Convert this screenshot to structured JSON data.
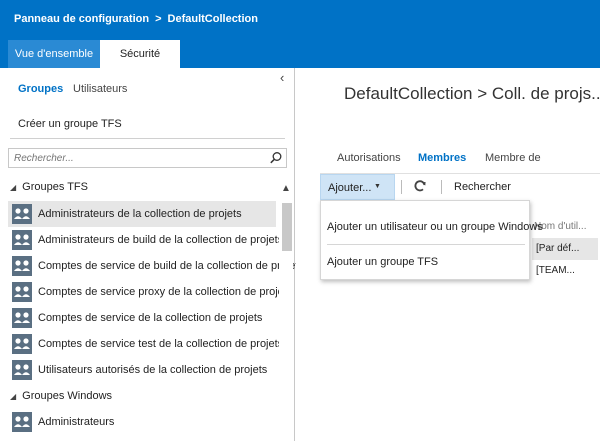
{
  "breadcrumb": {
    "root": "Panneau de configuration",
    "separator": ">",
    "current": "DefaultCollection"
  },
  "tabs": {
    "overview": "Vue d'ensemble",
    "security": "Sécurité"
  },
  "left": {
    "subnav": {
      "groups": "Groupes",
      "users": "Utilisateurs"
    },
    "create_group": "Créer un groupe TFS",
    "search_placeholder": "Rechercher...",
    "sections": {
      "tfs": "Groupes TFS",
      "windows": "Groupes Windows"
    },
    "tfs_groups": [
      {
        "label": "Administrateurs de la collection de projets",
        "selected": true
      },
      {
        "label": "Administrateurs de build de la collection de projets",
        "selected": false
      },
      {
        "label": "Comptes de service de build de la collection de projets",
        "selected": false
      },
      {
        "label": "Comptes de service proxy de la collection de projets",
        "selected": false
      },
      {
        "label": "Comptes de service de la collection de projets",
        "selected": false
      },
      {
        "label": "Comptes de service test de la collection de projets",
        "selected": false
      },
      {
        "label": "Utilisateurs autorisés de la collection de projets",
        "selected": false
      }
    ],
    "windows_groups": [
      {
        "label": "Administrateurs",
        "selected": false
      }
    ]
  },
  "right": {
    "title": "DefaultCollection > Coll. de projs...",
    "tabs": {
      "authorizations": "Autorisations",
      "members": "Membres",
      "member_of": "Membre de"
    },
    "toolbar": {
      "add_label": "Ajouter...",
      "search_label": "Rechercher"
    },
    "grid": {
      "header": "Nom d'util...",
      "rows": [
        "[Par déf...",
        "[TEAM..."
      ]
    },
    "dropdown": {
      "items": [
        "Ajouter un utilisateur ou un groupe Windows",
        "Ajouter un groupe TFS"
      ]
    }
  },
  "colors": {
    "brand": "#0072c6",
    "selected_row": "#e6e6e6",
    "add_button": "#cfe4f6"
  }
}
